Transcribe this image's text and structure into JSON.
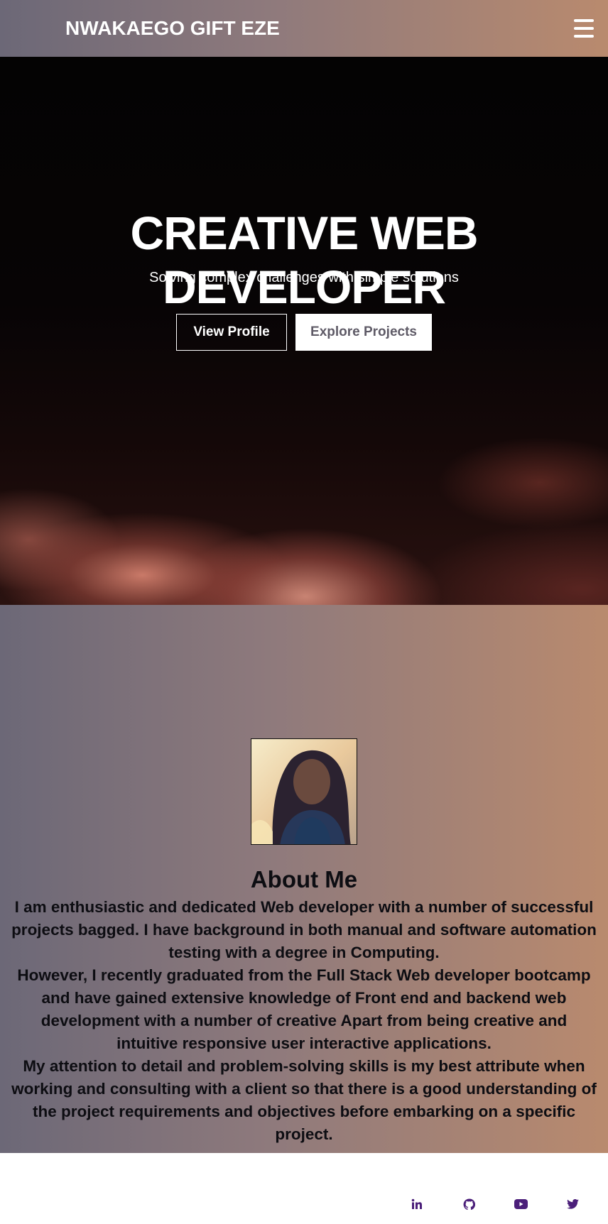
{
  "navbar": {
    "brand": "NWAKAEGO GIFT EZE",
    "menu_icon": "hamburger-menu-icon"
  },
  "hero": {
    "title": "CREATIVE WEB DEVELOPER",
    "subtitle": "Solving complex challenges with simple solutions",
    "buttons": {
      "view_profile": "View Profile",
      "explore_projects": "Explore Projects"
    }
  },
  "about": {
    "title": "About Me",
    "paragraphs": [
      "I am enthusiastic and dedicated Web developer with a number of successful projects bagged. I have background in both manual and software automation testing with a degree in Computing.",
      "However, I recently graduated from the Full Stack Web developer bootcamp and have gained extensive knowledge of Front end and backend web development with a number of creative Apart from being creative and intuitive responsive user interactive applications.",
      "My attention to detail and problem-solving skills is my best attribute when working and consulting with a client so that there is a good understanding of the project requirements and objectives before embarking on a specific project."
    ]
  },
  "footer": {
    "social_icons": [
      "linkedin-icon",
      "github-icon",
      "youtube-icon",
      "twitter-icon"
    ]
  },
  "colors": {
    "gradient_start": "#6c6877",
    "gradient_end": "#b98a6e",
    "social_icon": "#4b1f7a"
  }
}
